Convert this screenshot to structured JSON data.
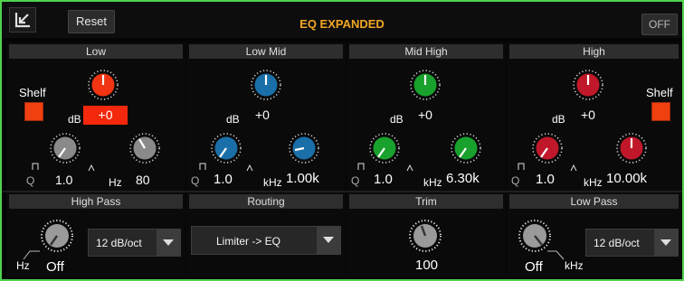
{
  "toolbar": {
    "title": "EQ EXPANDED",
    "reset_label": "Reset",
    "power_label": "OFF"
  },
  "colors": {
    "low": "#f23412",
    "low_mid": "#1a6fa8",
    "mid_high": "#18a12c",
    "high": "#c0182a",
    "accent": "#f2a624",
    "border": "#4fd34f"
  },
  "bands": [
    {
      "name": "Low",
      "shelf_label": "Shelf",
      "shelf_on": true,
      "gain_unit": "dB",
      "gain": "+0",
      "q_label": "Q",
      "q": "1.0",
      "freq_unit": "Hz",
      "freq": "80"
    },
    {
      "name": "Low Mid",
      "gain_unit": "dB",
      "gain": "+0",
      "q_label": "Q",
      "q": "1.0",
      "freq_unit": "kHz",
      "freq": "1.00k"
    },
    {
      "name": "Mid High",
      "gain_unit": "dB",
      "gain": "+0",
      "q_label": "Q",
      "q": "1.0",
      "freq_unit": "kHz",
      "freq": "6.30k"
    },
    {
      "name": "High",
      "shelf_label": "Shelf",
      "shelf_on": true,
      "gain_unit": "dB",
      "gain": "+0",
      "q_label": "Q",
      "q": "1.0",
      "freq_unit": "kHz",
      "freq": "10.00k"
    }
  ],
  "high_pass": {
    "title": "High Pass",
    "unit": "Hz",
    "value": "Off",
    "slope": "12 dB/oct"
  },
  "routing": {
    "title": "Routing",
    "value": "Limiter -> EQ"
  },
  "trim": {
    "title": "Trim",
    "value": "100"
  },
  "low_pass": {
    "title": "Low Pass",
    "unit": "kHz",
    "value": "Off",
    "slope": "12 dB/oct"
  }
}
